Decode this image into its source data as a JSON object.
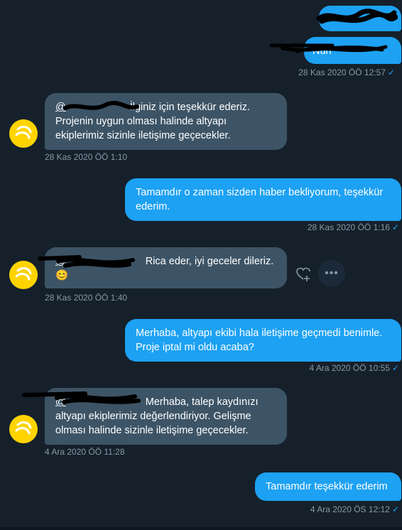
{
  "messages": [
    {
      "text": "",
      "time": ""
    },
    {
      "text": "Nuh",
      "time": "28 Kas 2020 ÖÖ 12:57"
    },
    {
      "mention": "@",
      "text": "İlginiz için teşekkür ederiz. Projenin uygun olması halinde altyapı ekiplerimiz sizinle iletişime geçecekler.",
      "time": "28 Kas 2020 ÖÖ 1:10"
    },
    {
      "text": "Tamamdır o zaman sizden haber bekliyorum, teşekkür ederim.",
      "time": "28 Kas 2020 ÖÖ 1:16"
    },
    {
      "mention": "@",
      "text": "Rica eder, iyi geceler dileriz.",
      "emoji": "😊",
      "time": "28 Kas 2020 ÖÖ 1:40"
    },
    {
      "text": "Merhaba, altyapı ekibi hala iletişime geçmedi benimle. Proje iptal mi oldu acaba?",
      "time": "4 Ara 2020 ÖÖ 10:55"
    },
    {
      "mention": "@",
      "text": "Merhaba, talep kaydınızı altyapı ekiplerimiz değerlendiriyor. Gelişme olması halinde sizinle iletişime geçecekler.",
      "time": "4 Ara 2020 ÖÖ 11:28"
    },
    {
      "text": "Tamamdır teşekkür ederim",
      "time": "4 Ara 2020 ÖS 12:12"
    }
  ],
  "icons": {
    "read_check": "✓",
    "like": "heart-plus-icon",
    "more": "more-icon",
    "more_glyph": "•••",
    "avatar_color": "#ffd400",
    "sent_color": "#1da1f2",
    "received_color": "#3d5466"
  }
}
